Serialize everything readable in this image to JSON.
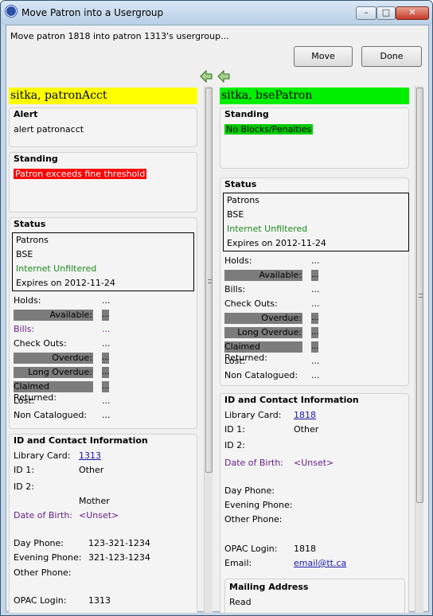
{
  "window": {
    "title": "Move Patron into a Usergroup"
  },
  "message": "Move patron 1818 into patron 1313's usergroup...",
  "buttons": {
    "move": "Move",
    "done": "Done"
  },
  "left": {
    "name": "sitka, patronAcct",
    "name_color": "#ffff00",
    "alert_title": "Alert",
    "alert_text": "alert patronacct",
    "standing_title": "Standing",
    "standing_text": "Patron exceeds fine threshold",
    "status_title": "Status",
    "status_lines": [
      "Patrons",
      "BSE",
      "Internet Unfiltered",
      "Expires on 2012-11-24"
    ],
    "counts": [
      {
        "label": "Holds:",
        "value": "..."
      },
      {
        "label": "Available:",
        "value": "..."
      },
      {
        "label": "Bills:",
        "value": "..."
      },
      {
        "label": "Check Outs:",
        "value": "..."
      },
      {
        "label": "Overdue:",
        "value": "..."
      },
      {
        "label": "Long Overdue:",
        "value": "..."
      },
      {
        "label": "Claimed Returned:",
        "value": "..."
      },
      {
        "label": "Lost:",
        "value": "..."
      },
      {
        "label": "Non Catalogued:",
        "value": "..."
      }
    ],
    "id_title": "ID and Contact Information",
    "id_rows": [
      {
        "label": "Library Card:",
        "value": "1313"
      },
      {
        "label": "ID 1:",
        "value": "Other"
      },
      {
        "label": "ID 2:",
        "value": "Mother"
      },
      {
        "label": "Date of Birth:",
        "value": "<Unset>"
      },
      {
        "label": "Day Phone:",
        "value": "123-321-1234"
      },
      {
        "label": "Evening Phone:",
        "value": "321-123-1234"
      },
      {
        "label": "Other Phone:",
        "value": ""
      },
      {
        "label": "OPAC Login:",
        "value": "1313"
      }
    ]
  },
  "right": {
    "name": "sitka, bsePatron",
    "name_color": "#00ee00",
    "standing_title": "Standing",
    "standing_text": "No Blocks/Penalties",
    "status_title": "Status",
    "status_lines": [
      "Patrons",
      "BSE",
      "Internet Unfiltered",
      "Expires on 2012-11-24"
    ],
    "counts": [
      {
        "label": "Holds:",
        "value": "..."
      },
      {
        "label": "Available:",
        "value": "..."
      },
      {
        "label": "Bills:",
        "value": "..."
      },
      {
        "label": "Check Outs:",
        "value": "..."
      },
      {
        "label": "Overdue:",
        "value": "..."
      },
      {
        "label": "Long Overdue:",
        "value": "..."
      },
      {
        "label": "Claimed Returned:",
        "value": "..."
      },
      {
        "label": "Lost:",
        "value": "..."
      },
      {
        "label": "Non Catalogued:",
        "value": "..."
      }
    ],
    "id_title": "ID and Contact Information",
    "id_rows": [
      {
        "label": "Library Card:",
        "value": "1818"
      },
      {
        "label": "ID 1:",
        "value": "Other"
      },
      {
        "label": "ID 2:",
        "value": ""
      },
      {
        "label": "Date of Birth:",
        "value": "<Unset>"
      },
      {
        "label": "Day Phone:",
        "value": ""
      },
      {
        "label": "Evening Phone:",
        "value": ""
      },
      {
        "label": "Other Phone:",
        "value": ""
      },
      {
        "label": "OPAC Login:",
        "value": "1818"
      },
      {
        "label": "Email:",
        "value": "email@tt.ca"
      }
    ],
    "mailing_title": "Mailing Address",
    "mailing_first": "Read"
  }
}
